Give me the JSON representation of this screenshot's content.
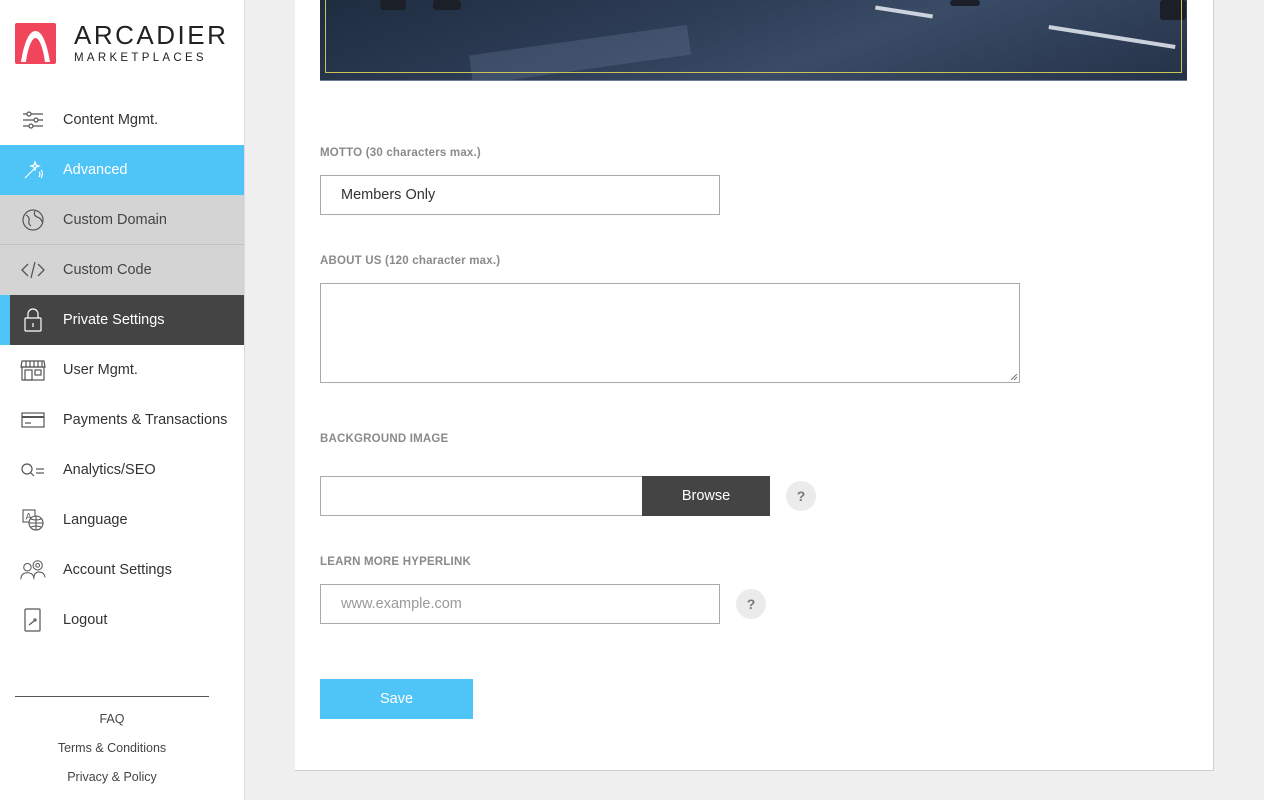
{
  "brand": {
    "name": "ARCADIER",
    "tagline": "MARKETPLACES",
    "accent_color": "#4fc4f7",
    "logo_color": "#f0455a"
  },
  "sidebar": {
    "items": [
      {
        "label": "Content Mgmt.",
        "icon": "sliders-icon"
      },
      {
        "label": "Advanced",
        "icon": "magic-wand-icon"
      },
      {
        "label": "Custom Domain",
        "icon": "globe-icon"
      },
      {
        "label": "Custom Code",
        "icon": "code-icon"
      },
      {
        "label": "Private Settings",
        "icon": "lock-icon"
      },
      {
        "label": "User Mgmt.",
        "icon": "storefront-icon"
      },
      {
        "label": "Payments & Transactions",
        "icon": "credit-card-icon"
      },
      {
        "label": "Analytics/SEO",
        "icon": "search-list-icon"
      },
      {
        "label": "Language",
        "icon": "language-icon"
      },
      {
        "label": "Account Settings",
        "icon": "users-gear-icon"
      },
      {
        "label": "Logout",
        "icon": "logout-icon"
      }
    ],
    "footer": {
      "faq": "FAQ",
      "terms": "Terms & Conditions",
      "privacy": "Privacy & Policy"
    }
  },
  "form": {
    "motto": {
      "label": "MOTTO (30 characters max.)",
      "value": "Members Only"
    },
    "about": {
      "label": "ABOUT US (120 character max.)",
      "value": ""
    },
    "background_image": {
      "label": "BACKGROUND IMAGE",
      "value": "",
      "browse_label": "Browse",
      "help": "?"
    },
    "learn_more": {
      "label": "LEARN MORE HYPERLINK",
      "value": "",
      "placeholder": "www.example.com",
      "help": "?"
    },
    "save_label": "Save"
  }
}
